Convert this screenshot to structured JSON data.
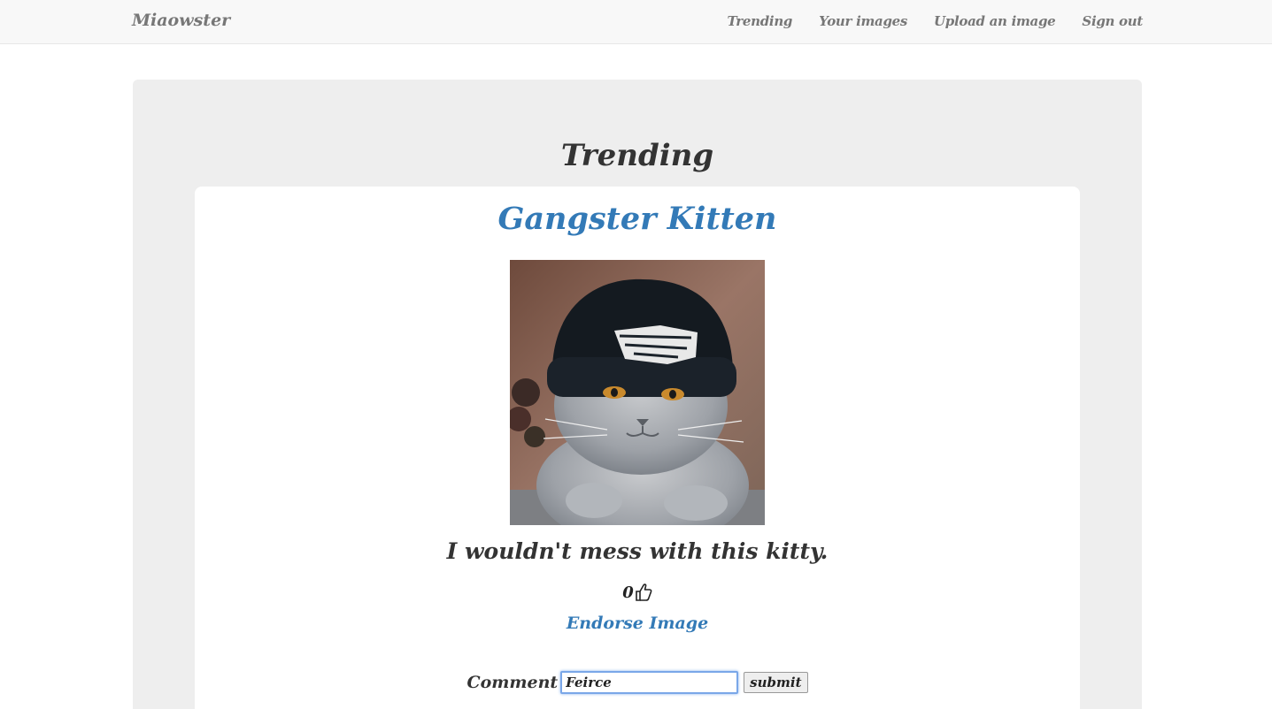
{
  "navbar": {
    "brand": "Miaowster",
    "links": [
      "Trending",
      "Your images",
      "Upload an image",
      "Sign out"
    ]
  },
  "page": {
    "heading": "Trending"
  },
  "post": {
    "title": "Gangster Kitten",
    "image_alt": "grey cat wearing a black beanie",
    "caption": "I wouldn't mess with this kitty.",
    "like_count": "0",
    "like_icon": "thumbs-up-icon",
    "endorse_label": "Endorse Image"
  },
  "comment_form": {
    "label": "Comment",
    "value": "Feirce",
    "submit_label": "submit"
  },
  "colors": {
    "link": "#337ab7",
    "navbar_bg": "#f8f8f8",
    "jumbotron_bg": "#eeeeee"
  }
}
